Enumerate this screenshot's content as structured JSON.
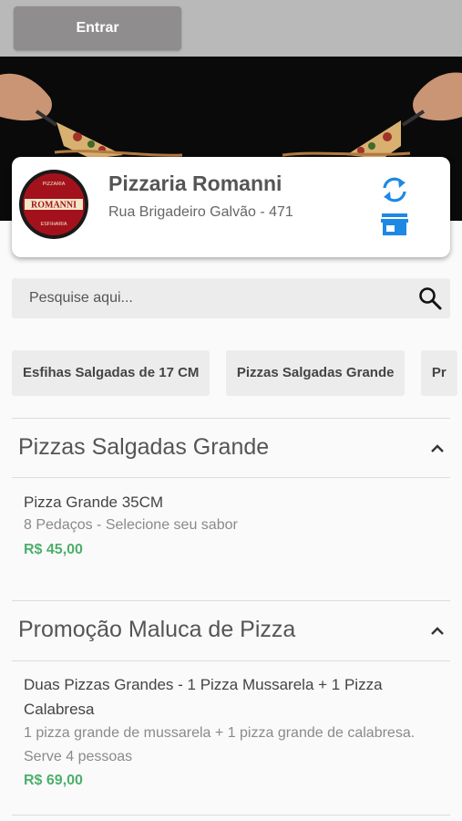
{
  "header": {
    "login_label": "Entrar"
  },
  "store": {
    "name": "Pizzaria Romanni",
    "address": "Rua Brigadeiro Galvão - 471",
    "logo_text": "ROMANNI",
    "logo_top_text": "PIZZARIA",
    "logo_bottom_text": "ESFIHARIA"
  },
  "search": {
    "placeholder": "Pesquise aqui..."
  },
  "categories": [
    {
      "label": "Esfihas Salgadas de 17 CM"
    },
    {
      "label": "Pizzas Salgadas Grande"
    },
    {
      "label": "Pr"
    }
  ],
  "sections": [
    {
      "title": "Pizzas Salgadas Grande",
      "items": [
        {
          "name": "Pizza Grande 35CM",
          "description": "8 Pedaços - Selecione seu sabor",
          "price": "R$ 45,00"
        }
      ]
    },
    {
      "title": "Promoção Maluca de Pizza",
      "items": [
        {
          "name_line1": "Duas Pizzas Grandes - 1 Pizza Mussarela + 1 Pizza",
          "name_line2": "Calabresa",
          "description_line1": "1 pizza grande de mussarela + 1 pizza grande de calabresa.",
          "description_line2": "Serve 4 pessoas",
          "price": "R$ 69,00"
        }
      ]
    }
  ],
  "colors": {
    "accent_blue": "#1e88e5",
    "price_green": "#4caf6b",
    "logo_red": "#a3121c"
  }
}
